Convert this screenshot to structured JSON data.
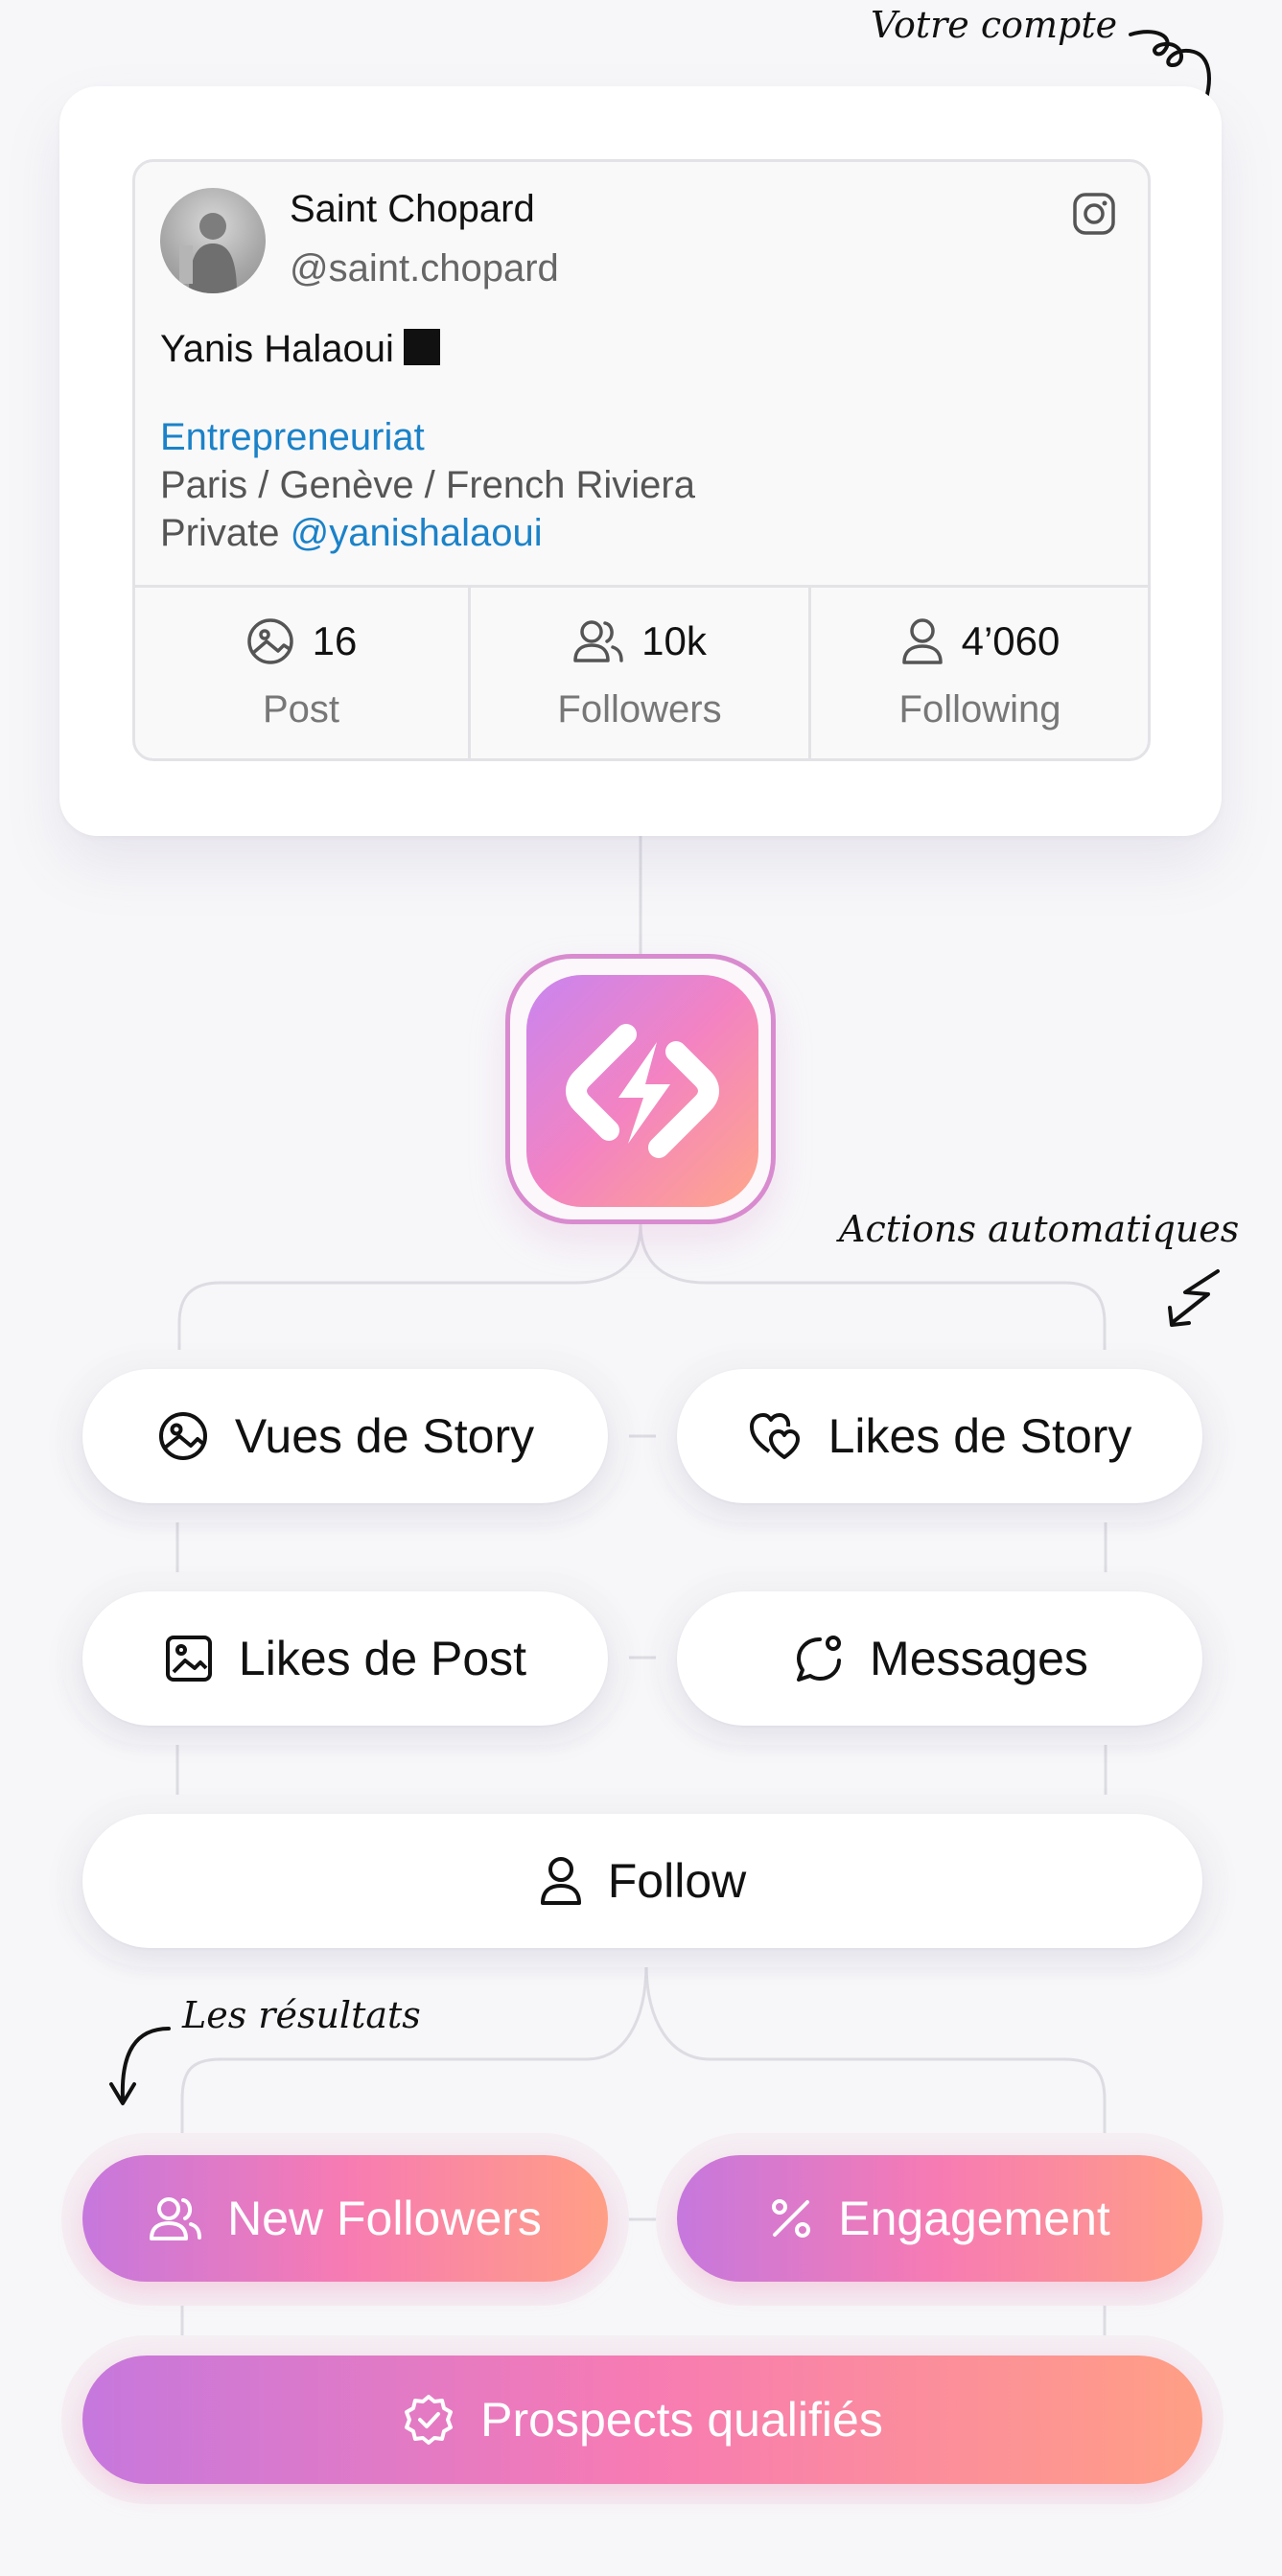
{
  "annotations": {
    "account": "Votre compte",
    "actions": "Actions automatiques",
    "results": "Les résultats"
  },
  "profile": {
    "name": "Saint Chopard",
    "handle": "@saint.chopard",
    "bio_name": "Yanis Halaoui",
    "bio_category": "Entrepreneuriat",
    "bio_location": "Paris / Genève / French Riviera",
    "bio_private_prefix": "Private",
    "bio_private_link": "@yanishalaoui",
    "platform_icon": "instagram-icon"
  },
  "stats": [
    {
      "value": "16",
      "label": "Post",
      "icon": "image-icon"
    },
    {
      "value": "10k",
      "label": "Followers",
      "icon": "users-icon"
    },
    {
      "value": "4’060",
      "label": "Following",
      "icon": "user-icon"
    }
  ],
  "actions": [
    {
      "label": "Vues de Story",
      "icon": "story-view-icon"
    },
    {
      "label": "Likes de Story",
      "icon": "hearts-icon"
    },
    {
      "label": "Likes de Post",
      "icon": "image-frame-icon"
    },
    {
      "label": "Messages",
      "icon": "message-icon"
    },
    {
      "label": "Follow",
      "icon": "user-icon"
    }
  ],
  "results": [
    {
      "label": "New Followers",
      "icon": "users-icon"
    },
    {
      "label": "Engagement",
      "icon": "percent-icon"
    },
    {
      "label": "Prospects qualifiés",
      "icon": "badge-check-icon"
    }
  ],
  "colors": {
    "link": "#1b82c8",
    "gradient_start": "#c678dd",
    "gradient_mid": "#f77bb3",
    "gradient_end": "#ff9f85"
  }
}
